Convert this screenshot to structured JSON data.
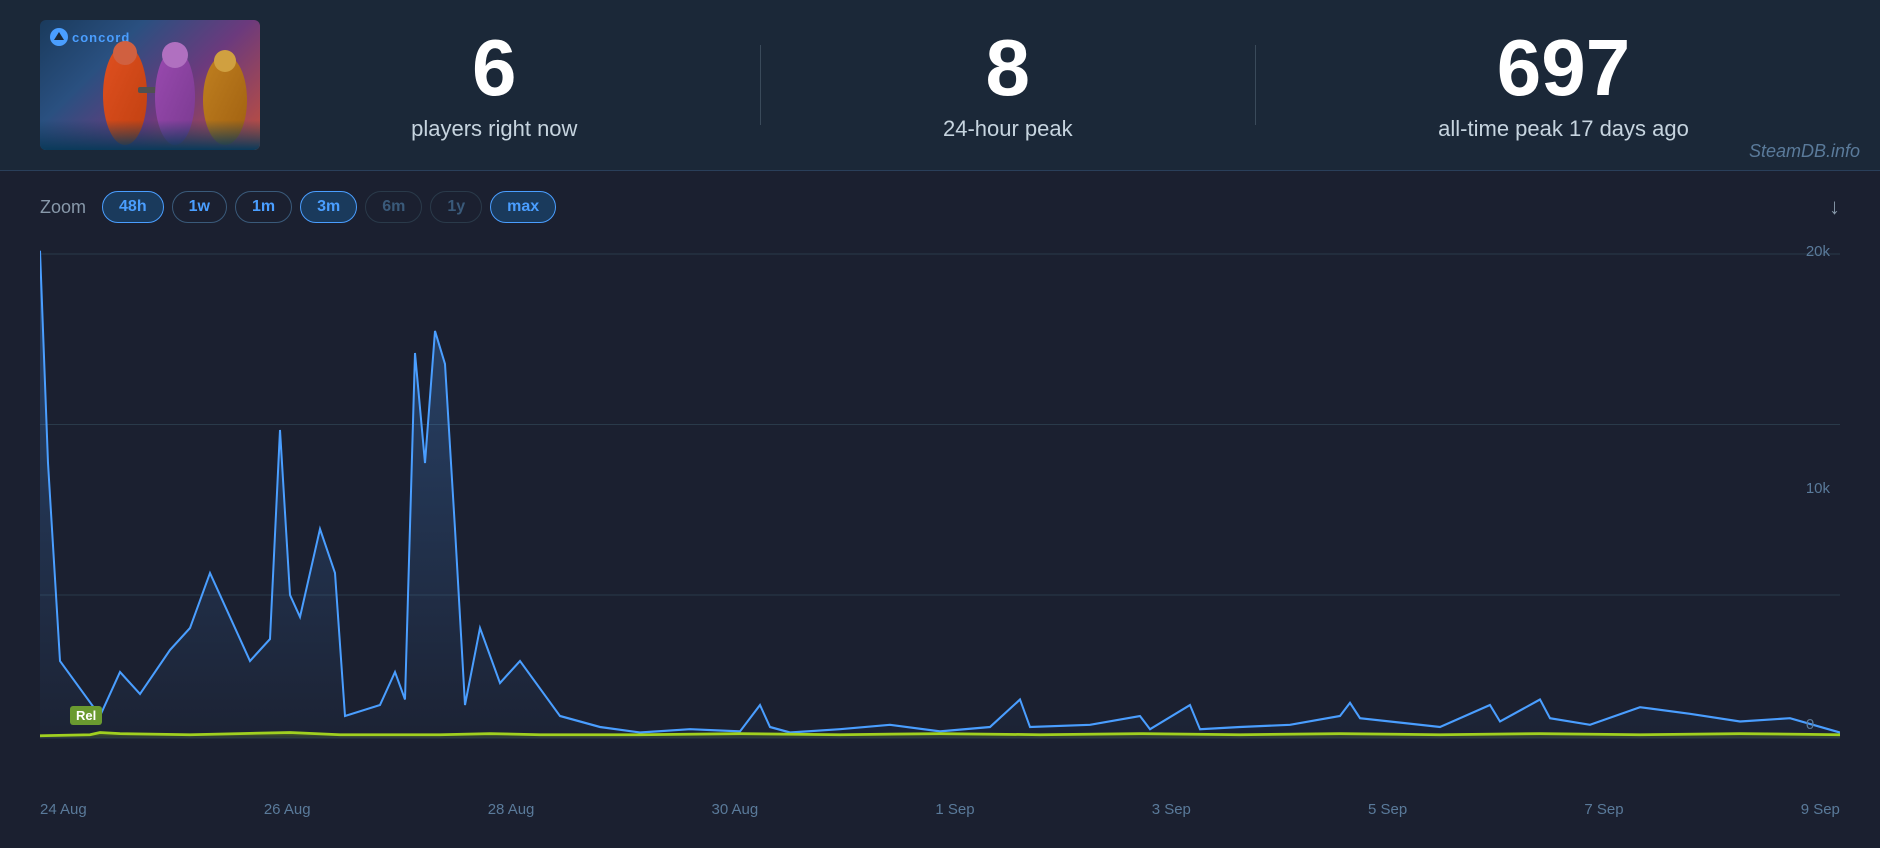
{
  "header": {
    "game_name": "Concord",
    "logo_text": "concord",
    "stats": [
      {
        "id": "players_now",
        "number": "6",
        "label": "players right now"
      },
      {
        "id": "peak_24h",
        "number": "8",
        "label": "24-hour peak"
      },
      {
        "id": "alltime_peak",
        "number": "697",
        "label": "all-time peak 17 days ago"
      }
    ],
    "credit": "SteamDB.info"
  },
  "chart": {
    "zoom_label": "Zoom",
    "zoom_buttons": [
      {
        "label": "48h",
        "active": true
      },
      {
        "label": "1w",
        "active": false
      },
      {
        "label": "1m",
        "active": false
      },
      {
        "label": "3m",
        "active": true
      },
      {
        "label": "6m",
        "dimmed": true
      },
      {
        "label": "1y",
        "dimmed": true
      },
      {
        "label": "max",
        "active": true
      }
    ],
    "y_axis": [
      "20k",
      "10k",
      "0"
    ],
    "x_axis": [
      "24 Aug",
      "26 Aug",
      "28 Aug",
      "30 Aug",
      "1 Sep",
      "3 Sep",
      "5 Sep",
      "7 Sep",
      "9 Sep"
    ],
    "rel_badge": "Rel",
    "download_icon": "↓"
  }
}
